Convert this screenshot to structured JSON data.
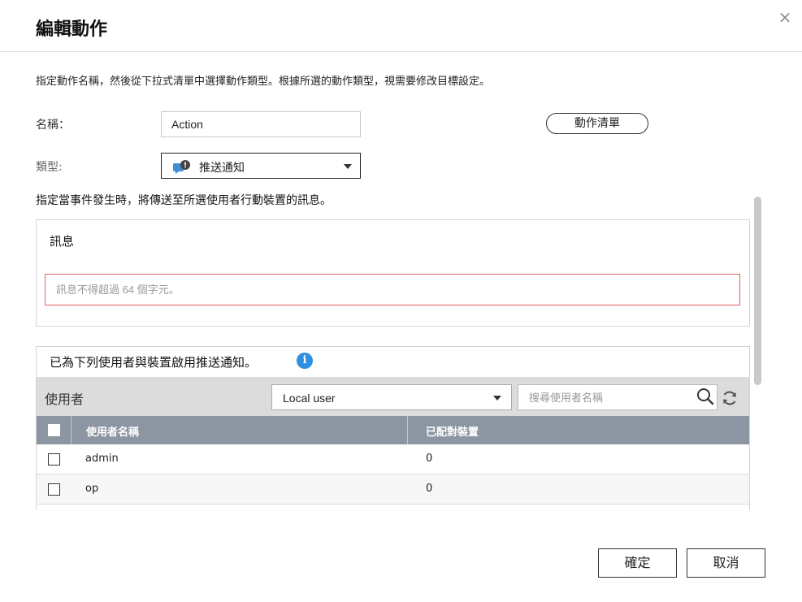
{
  "dialog": {
    "title": "編輯動作",
    "close_label": "×",
    "description": "指定動作名稱，然後從下拉式清單中選擇動作類型。根據所選的動作類型，視需要修改目標設定。"
  },
  "form": {
    "name_label": "名稱：",
    "name_value": "Action",
    "action_list_label": "動作清單",
    "type_label": "類型:",
    "type_value": "推送通知",
    "type_icon": "chat-bubble-alert-icon"
  },
  "push": {
    "instruction": "指定當事件發生時，將傳送至所選使用者行動裝置的訊息。",
    "message_title": "訊息",
    "message_value": "",
    "message_placeholder": "訊息不得超過 64 個字元。",
    "users_title": "已為下列使用者與裝置啟用推送通知。",
    "info_icon_glyph": "i"
  },
  "user_filter": {
    "label": "使用者",
    "source_value": "Local user",
    "search_placeholder": "搜尋使用者名稱"
  },
  "table": {
    "columns": [
      "使用者名稱",
      "已配對裝置"
    ],
    "rows": [
      {
        "user": "admin",
        "devices": "0"
      },
      {
        "user": "op",
        "devices": "0"
      }
    ]
  },
  "footer": {
    "ok_label": "確定",
    "cancel_label": "取消"
  },
  "colors": {
    "accent_blue": "#2f8fe0",
    "error_border": "#e0605a",
    "table_header": "#8c96a3"
  }
}
